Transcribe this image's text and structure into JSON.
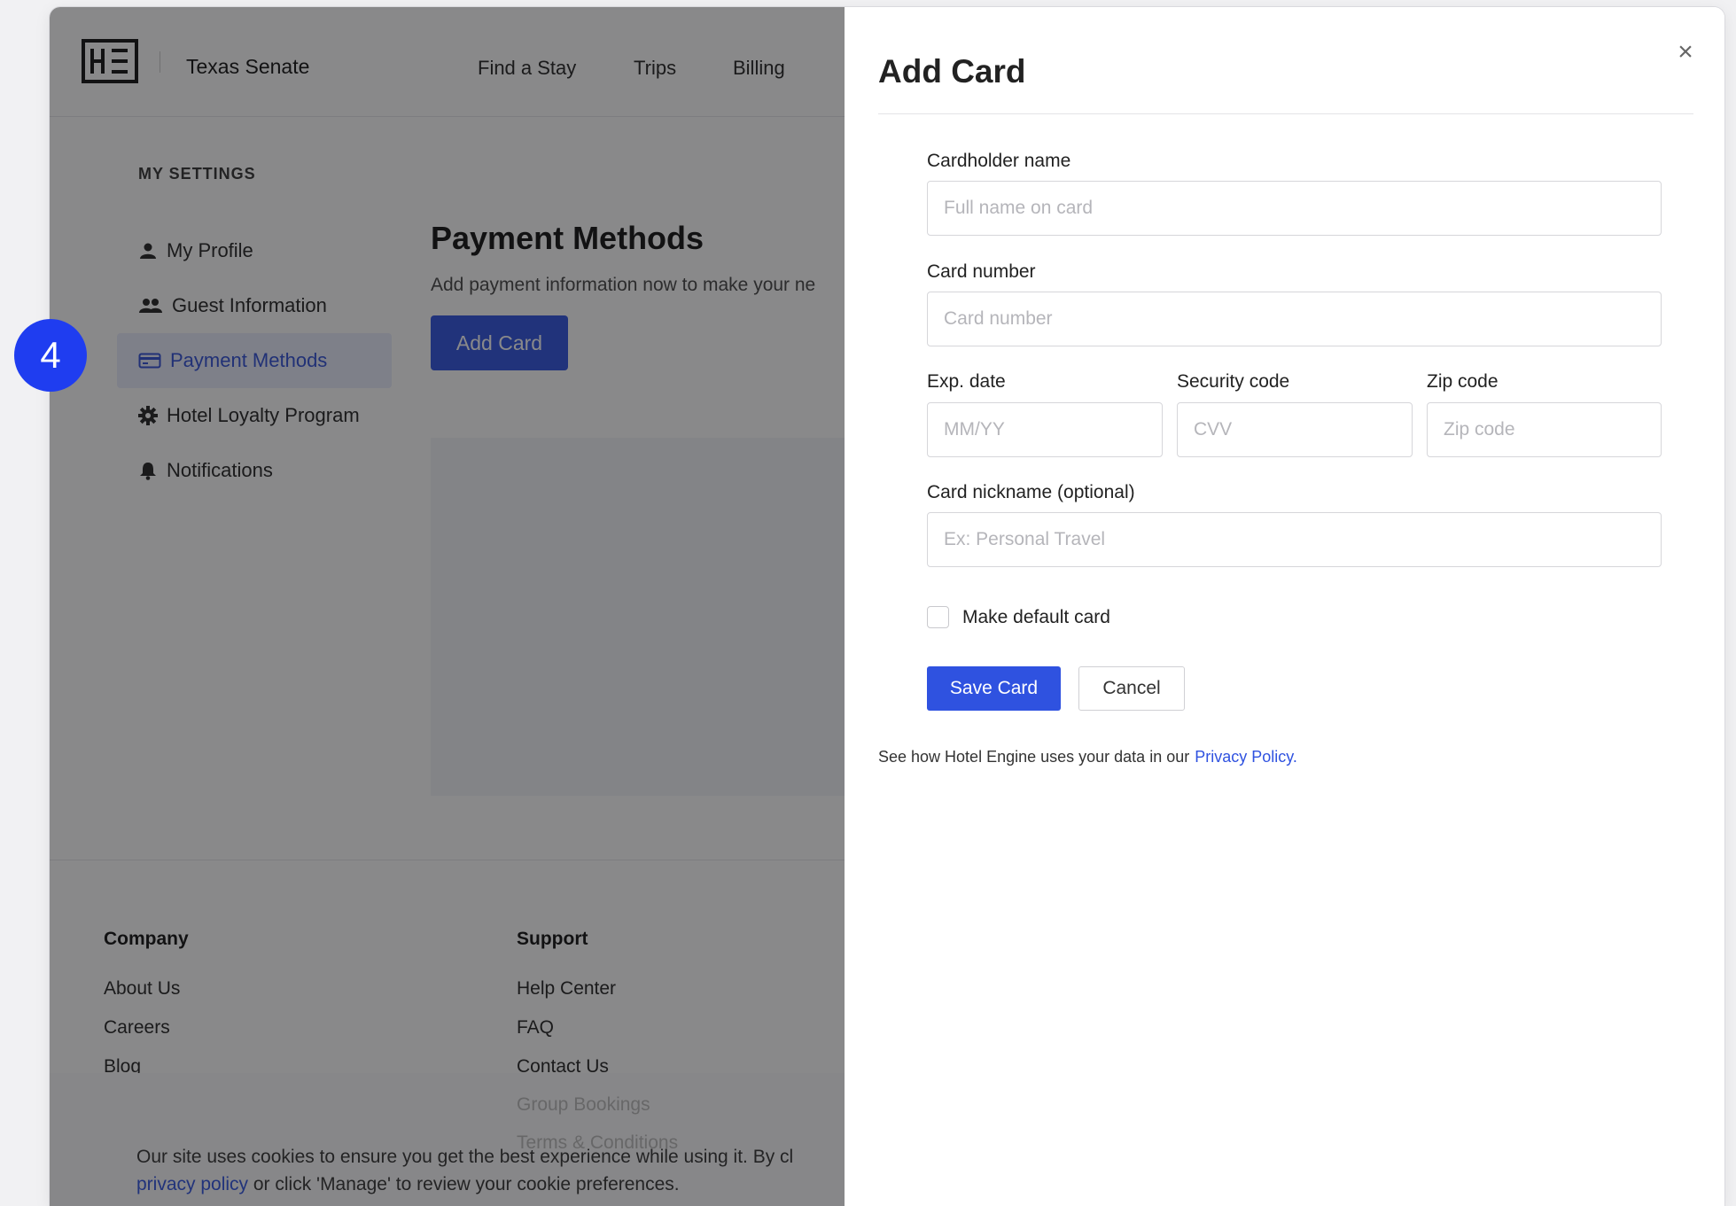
{
  "header": {
    "org_name": "Texas Senate",
    "nav": [
      "Find a Stay",
      "Trips",
      "Billing"
    ]
  },
  "sidebar": {
    "heading": "MY SETTINGS",
    "items": [
      {
        "label": "My Profile",
        "icon": "user-icon"
      },
      {
        "label": "Guest Information",
        "icon": "users-icon"
      },
      {
        "label": "Payment Methods",
        "icon": "credit-card-icon"
      },
      {
        "label": "Hotel Loyalty Program",
        "icon": "gear-icon"
      },
      {
        "label": "Notifications",
        "icon": "bell-icon"
      }
    ]
  },
  "main": {
    "title": "Payment Methods",
    "description": "Add payment information now to make your ne",
    "add_card_label": "Add Card"
  },
  "footer": {
    "company_heading": "Company",
    "company_links": [
      "About Us",
      "Careers",
      "Blog"
    ],
    "support_heading": "Support",
    "support_links": [
      "Help Center",
      "FAQ",
      "Contact Us",
      "Group Bookings",
      "Terms & Conditions"
    ]
  },
  "cookie": {
    "line1": "Our site uses cookies to ensure you get the best experience while using it. By cl",
    "link": "privacy policy",
    "line2_rest": " or click 'Manage' to review your cookie preferences."
  },
  "drawer": {
    "title": "Add Card",
    "close_label": "×",
    "cardholder_label": "Cardholder name",
    "cardholder_placeholder": "Full name on card",
    "card_number_label": "Card number",
    "card_number_placeholder": "Card number",
    "exp_label": "Exp. date",
    "exp_placeholder": "MM/YY",
    "security_label": "Security code",
    "security_placeholder": "CVV",
    "zip_label": "Zip code",
    "zip_placeholder": "Zip code",
    "nickname_label": "Card nickname (optional)",
    "nickname_placeholder": "Ex: Personal Travel",
    "default_label": "Make default card",
    "save_label": "Save Card",
    "cancel_label": "Cancel",
    "privacy_text": "See how Hotel Engine uses your data in our",
    "privacy_link": "Privacy Policy."
  },
  "step_badge": "4",
  "colors": {
    "accent": "#2f52e0",
    "badge": "#1f3df0"
  }
}
